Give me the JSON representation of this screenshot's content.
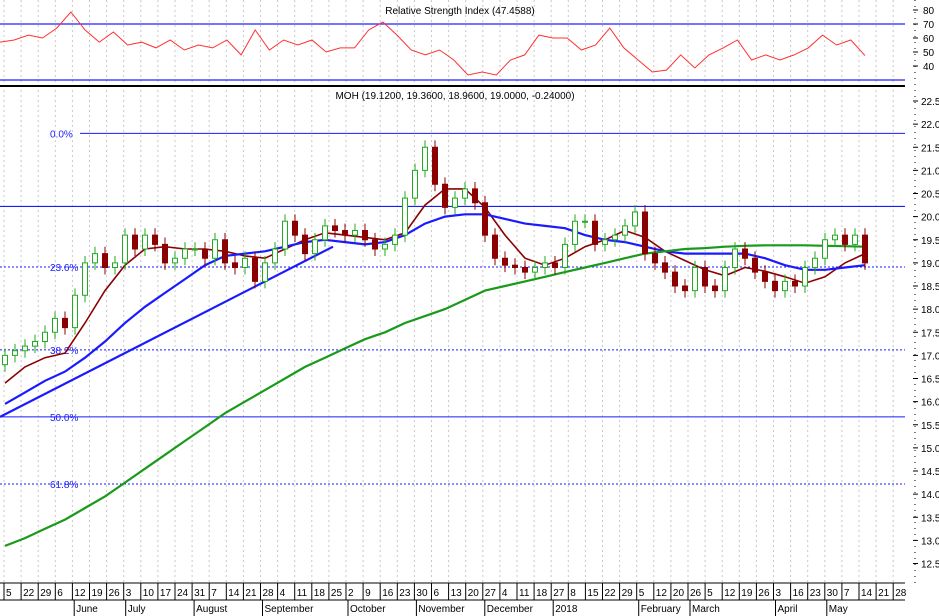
{
  "chart_data": {
    "type": "candlestick",
    "rsi_panel": {
      "title": "Relative Strength Index (47.4588)",
      "ylim": [
        30,
        85
      ],
      "ticks": [
        "80",
        "70",
        "60",
        "50",
        "40"
      ],
      "tick_values": [
        80,
        70,
        60,
        50,
        40
      ],
      "levels": [
        70,
        30
      ],
      "values": [
        57.1,
        58.6,
        62.1,
        60,
        67.1,
        78.6,
        65.7,
        57.1,
        64.3,
        55,
        57,
        52.9,
        58.6,
        51.4,
        55,
        52.9,
        58.6,
        47.9,
        65.7,
        51.4,
        58.6,
        55,
        58.6,
        50,
        52.9,
        52.9,
        65.7,
        71.4,
        62.1,
        51.4,
        47.9,
        51.4,
        44.3,
        33.6,
        35.7,
        33.6,
        44.3,
        47.9,
        62.1,
        60,
        60,
        51.4,
        55,
        67.1,
        52.9,
        44.3,
        35.7,
        37.1,
        47.9,
        38.6,
        47.9,
        52.9,
        58.6,
        44.3,
        47.9,
        44.3,
        47.9,
        52.9,
        62.1,
        55,
        58.6,
        47.46
      ],
      "line_color": "#ff3030",
      "level_color": "#2020ff"
    },
    "price_panel": {
      "title": "MOH (19.1200, 19.3600, 18.9600, 19.0000, -0.24000)",
      "ylim": [
        12.0,
        22.8
      ],
      "ticks": [
        "22.5",
        "22.0",
        "21.5",
        "21.0",
        "20.5",
        "20.0",
        "19.5",
        "19.0",
        "18.5",
        "18.0",
        "17.5",
        "17.0",
        "16.5",
        "16.0",
        "15.5",
        "15.0",
        "14.5",
        "14.0",
        "13.5",
        "13.0",
        "12.5"
      ],
      "closes": [
        17.0,
        17.1,
        17.2,
        17.3,
        17.5,
        17.8,
        17.6,
        18.3,
        19.0,
        19.2,
        18.9,
        19.0,
        19.6,
        19.3,
        19.6,
        19.4,
        19.0,
        19.1,
        19.3,
        19.3,
        19.1,
        19.5,
        19.0,
        18.9,
        19.1,
        18.6,
        19.0,
        19.3,
        19.9,
        19.6,
        19.2,
        19.5,
        19.8,
        19.7,
        19.6,
        19.7,
        19.5,
        19.3,
        19.4,
        19.6,
        20.4,
        21.0,
        21.5,
        20.7,
        20.2,
        20.4,
        20.6,
        20.3,
        19.6,
        19.1,
        18.95,
        18.9,
        18.8,
        18.9,
        19.0,
        18.9,
        19.4,
        19.9,
        19.9,
        19.4,
        19.5,
        19.6,
        19.8,
        20.1,
        19.2,
        19.0,
        18.8,
        18.5,
        18.4,
        18.9,
        18.5,
        18.4,
        18.9,
        19.3,
        19.1,
        18.8,
        18.6,
        18.4,
        18.6,
        18.5,
        18.9,
        19.1,
        19.5,
        19.6,
        19.4,
        19.6,
        19.0
      ],
      "first_open": 16.8,
      "up_color": "#22aa22",
      "down_color": "#8b0000",
      "moving_averages": [
        {
          "name": "short MA",
          "color": "#8b0000",
          "sample_every_bars": 2,
          "values": [
            16.4,
            16.75,
            16.95,
            17.05,
            17.7,
            18.4,
            18.95,
            19.3,
            19.35,
            19.3,
            19.3,
            19.25,
            19.15,
            19.1,
            19.3,
            19.5,
            19.65,
            19.6,
            19.55,
            19.5,
            19.65,
            20.25,
            20.6,
            20.6,
            20.2,
            19.6,
            19.1,
            18.95,
            19.1,
            19.35,
            19.5,
            19.7,
            19.55,
            19.25,
            19.05,
            18.85,
            18.72,
            18.9,
            18.82,
            18.7,
            18.56,
            18.7,
            19.0,
            19.2
          ]
        },
        {
          "name": "medium MA",
          "color": "#1a1aff",
          "sample_every_bars": 2,
          "values": [
            15.95,
            16.2,
            16.45,
            16.65,
            16.95,
            17.3,
            17.7,
            18.05,
            18.35,
            18.65,
            18.95,
            19.15,
            19.2,
            19.25,
            19.35,
            19.45,
            19.5,
            19.45,
            19.4,
            19.45,
            19.6,
            19.85,
            20.0,
            20.05,
            20.05,
            19.95,
            19.85,
            19.8,
            19.75,
            19.6,
            19.5,
            19.45,
            19.35,
            19.25,
            19.2,
            19.2,
            19.2,
            19.2,
            19.1,
            18.95,
            18.85,
            18.85,
            18.9,
            18.95
          ]
        },
        {
          "name": "long MA",
          "color": "#1a9a1a",
          "sample_every_bars": 2,
          "values": [
            12.88,
            13.05,
            13.25,
            13.45,
            13.7,
            13.95,
            14.25,
            14.55,
            14.85,
            15.15,
            15.45,
            15.75,
            16.0,
            16.25,
            16.5,
            16.75,
            16.95,
            17.15,
            17.35,
            17.5,
            17.7,
            17.85,
            18.0,
            18.2,
            18.4,
            18.5,
            18.6,
            18.7,
            18.8,
            18.9,
            19.0,
            19.1,
            19.2,
            19.25,
            19.3,
            19.32,
            19.35,
            19.37,
            19.38,
            19.38,
            19.38,
            19.37,
            19.36,
            19.35
          ]
        }
      ],
      "trendline": {
        "color": "#1a1aff",
        "points": [
          {
            "bar": -0.5,
            "price": 15.67
          },
          {
            "bar": 32.8,
            "price": 19.35
          }
        ]
      },
      "resistance_line": {
        "price": 20.22,
        "color": "#1a1aff"
      },
      "fibonacci": [
        {
          "label": "0.0%",
          "price": 21.8,
          "style": "solid"
        },
        {
          "label": "23.6%",
          "price": 18.91,
          "style": "dotted"
        },
        {
          "label": "38.2%",
          "price": 17.12,
          "style": "dotted"
        },
        {
          "label": "50.0%",
          "price": 15.67,
          "style": "solid"
        },
        {
          "label": "61.8%",
          "price": 14.22,
          "style": "dotted"
        }
      ]
    },
    "x_axis": {
      "day_ticks": [
        "5",
        "22",
        "29",
        "6",
        "12",
        "19",
        "26",
        "3",
        "10",
        "17",
        "24",
        "31",
        "7",
        "14",
        "21",
        "28",
        "4",
        "11",
        "18",
        "25",
        "2",
        "9",
        "16",
        "23",
        "30",
        "6",
        "13",
        "20",
        "27",
        "4",
        "11",
        "18",
        "27",
        "8",
        "15",
        "22",
        "29",
        "5",
        "12",
        "20",
        "26",
        "5",
        "12",
        "19",
        "26",
        "3",
        "16",
        "23",
        "30",
        "7",
        "14",
        "21",
        "28"
      ],
      "months": [
        {
          "label": "June",
          "tick": 2
        },
        {
          "label": "July",
          "tick": 7
        },
        {
          "label": "August",
          "tick": 11
        },
        {
          "label": "September",
          "tick": 15
        },
        {
          "label": "October",
          "tick": 20
        },
        {
          "label": "November",
          "tick": 24
        },
        {
          "label": "December",
          "tick": 28
        },
        {
          "label": "2018",
          "tick": 32
        },
        {
          "label": "February",
          "tick": 37
        },
        {
          "label": "March",
          "tick": 40
        },
        {
          "label": "April",
          "tick": 45
        },
        {
          "label": "May",
          "tick": 48
        }
      ]
    },
    "grid": true
  }
}
